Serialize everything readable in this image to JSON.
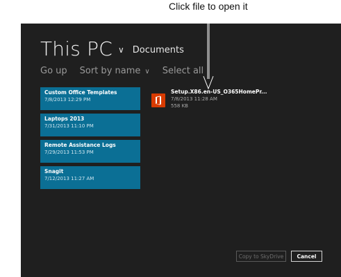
{
  "annotation": {
    "text": "Click file to open it"
  },
  "header": {
    "title": "This PC",
    "location": "Documents"
  },
  "commands": {
    "go_up": "Go up",
    "sort_by": "Sort by name",
    "select_all": "Select all"
  },
  "folders": [
    {
      "name": "Custom Office Templates",
      "date": "7/8/2013 12:29 PM"
    },
    {
      "name": "Laptops 2013",
      "date": "7/31/2013 11:10 PM"
    },
    {
      "name": "Remote Assistance Logs",
      "date": "7/29/2013 11:53 PM"
    },
    {
      "name": "Snagit",
      "date": "7/12/2013 11:27 AM"
    }
  ],
  "file": {
    "name": "Setup.X86.en-US_O365HomePr...",
    "date": "7/8/2013 11:28 AM",
    "size": "558 KB",
    "icon": "office-icon"
  },
  "buttons": {
    "copy": "Copy to SkyDrive",
    "cancel": "Cancel"
  },
  "colors": {
    "background": "#1f1f1f",
    "tile": "#0b6f95",
    "office_icon": "#d83b01"
  }
}
